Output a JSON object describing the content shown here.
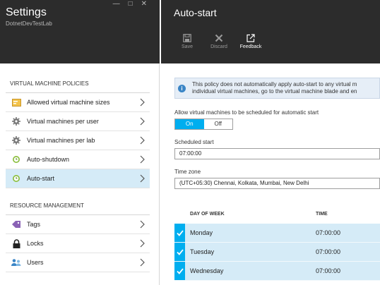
{
  "left": {
    "title": "Settings",
    "subtitle": "DotnetDevTestLab",
    "vm_policies_title": "VIRTUAL MACHINE POLICIES",
    "vm_items": [
      {
        "label": "Allowed virtual machine sizes",
        "icon": "vm-sizes-icon"
      },
      {
        "label": "Virtual machines per user",
        "icon": "gear-icon"
      },
      {
        "label": "Virtual machines per lab",
        "icon": "gear-icon"
      },
      {
        "label": "Auto-shutdown",
        "icon": "clock-icon"
      },
      {
        "label": "Auto-start",
        "icon": "clock-icon"
      }
    ],
    "resource_title": "RESOURCE MANAGEMENT",
    "resource_items": [
      {
        "label": "Tags",
        "icon": "tag-icon"
      },
      {
        "label": "Locks",
        "icon": "lock-icon"
      },
      {
        "label": "Users",
        "icon": "users-icon"
      }
    ]
  },
  "right": {
    "title": "Auto-start",
    "commands": {
      "save": "Save",
      "discard": "Discard",
      "feedback": "Feedback"
    },
    "info_line1": "This policy does not automatically apply auto-start to any virtual m",
    "info_line2": "individual virtual machines, go to the virtual machine blade and en",
    "allow_label": "Allow virtual machines to be scheduled for automatic start",
    "toggle_on": "On",
    "toggle_off": "Off",
    "scheduled_label": "Scheduled start",
    "scheduled_value": "07:00:00",
    "timezone_label": "Time zone",
    "timezone_value": "(UTC+05:30) Chennai, Kolkata, Mumbai, New Delhi",
    "table": {
      "headers": [
        "DAY OF WEEK",
        "TIME"
      ],
      "rows": [
        {
          "day": "Monday",
          "time": "07:00:00"
        },
        {
          "day": "Tuesday",
          "time": "07:00:00"
        },
        {
          "day": "Wednesday",
          "time": "07:00:00"
        }
      ]
    }
  },
  "colors": {
    "accent": "#00aeef",
    "header_bg": "#2c2c2c",
    "selected_bg": "#d5ebf7"
  }
}
